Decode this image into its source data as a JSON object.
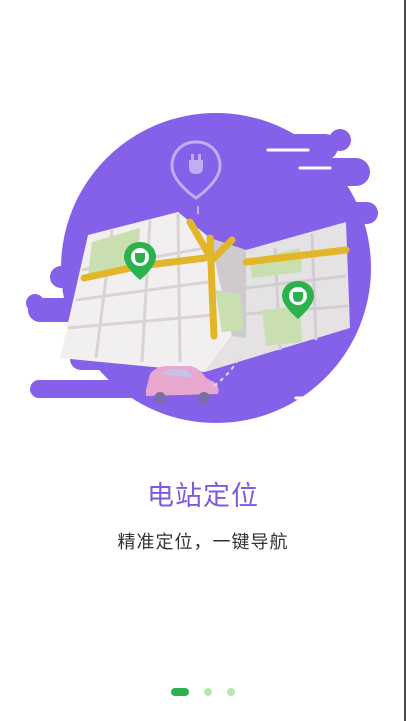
{
  "guide": {
    "title": "电站定位",
    "subtitle": "精准定位，一键导航"
  },
  "pager": {
    "page_count": 3,
    "active_index": 0
  },
  "colors": {
    "accent_purple": "#8560e8",
    "title_purple": "#7f59e0",
    "pin_green": "#2bb24c",
    "road_yellow": "#e3b62a",
    "map_green": "#c9dfb0",
    "car_pink": "#e8a7cf"
  }
}
